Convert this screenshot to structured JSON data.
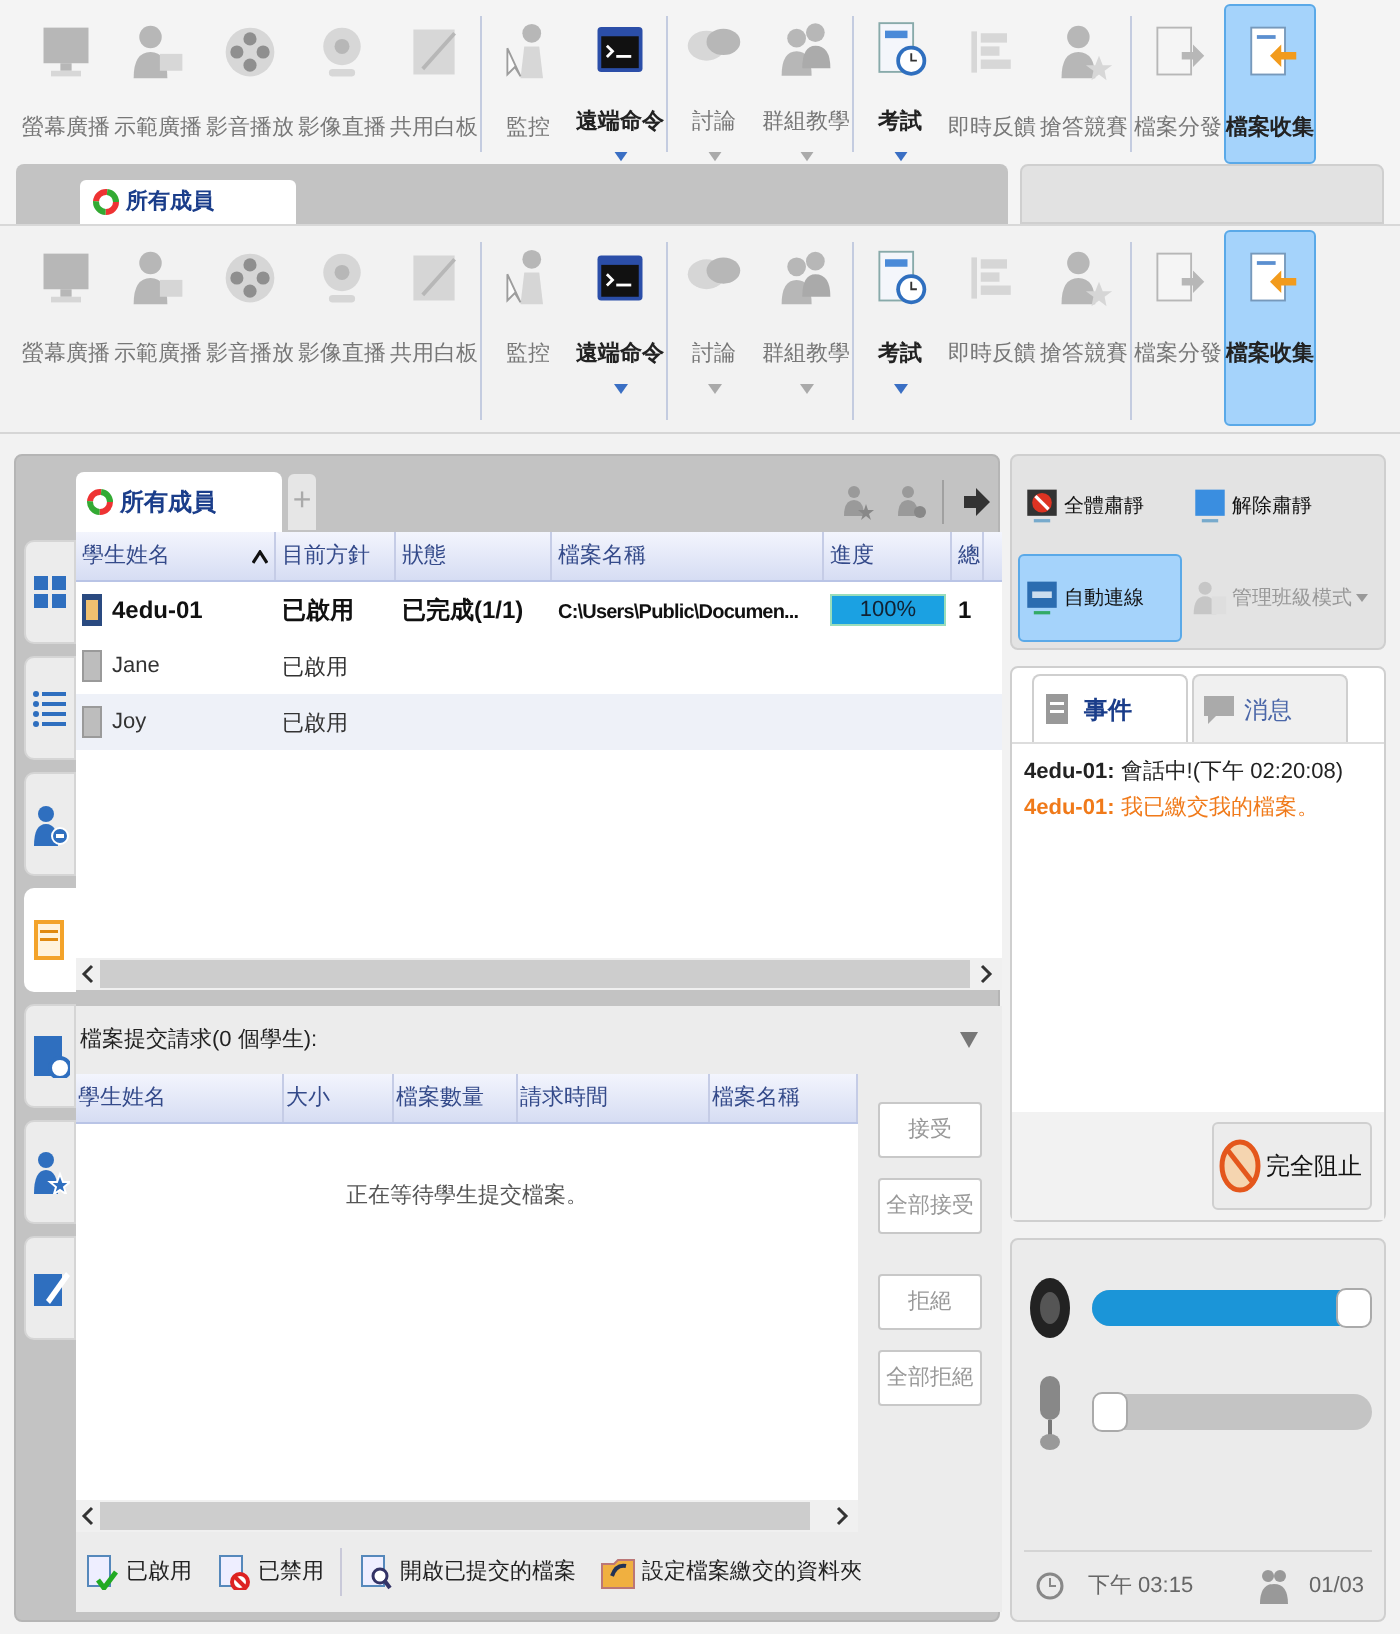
{
  "background_copy": {
    "toolbar": [
      {
        "items": [
          {
            "label": "螢幕廣播",
            "enabled": false,
            "dropdown": false,
            "selected": false
          },
          {
            "label": "示範廣播",
            "enabled": false,
            "dropdown": false,
            "selected": false
          },
          {
            "label": "影音播放",
            "enabled": false,
            "dropdown": false,
            "selected": false
          },
          {
            "label": "影像直播",
            "enabled": false,
            "dropdown": false,
            "selected": false
          },
          {
            "label": "共用白板",
            "enabled": false,
            "dropdown": false,
            "selected": false
          }
        ]
      },
      {
        "items": [
          {
            "label": "監控",
            "enabled": false,
            "dropdown": false,
            "selected": false
          },
          {
            "label": "遠端命令",
            "enabled": true,
            "dropdown": true,
            "selected": false
          }
        ]
      },
      {
        "items": [
          {
            "label": "討論",
            "enabled": false,
            "dropdown": true,
            "selected": false
          },
          {
            "label": "群組教學",
            "enabled": false,
            "dropdown": true,
            "selected": false
          }
        ]
      },
      {
        "items": [
          {
            "label": "考試",
            "enabled": true,
            "dropdown": true,
            "selected": false
          },
          {
            "label": "即時反饋",
            "enabled": false,
            "dropdown": false,
            "selected": false
          },
          {
            "label": "搶答競賽",
            "enabled": false,
            "dropdown": false,
            "selected": false
          }
        ]
      },
      {
        "items": [
          {
            "label": "檔案分發",
            "enabled": false,
            "dropdown": false,
            "selected": false
          },
          {
            "label": "檔案收集",
            "enabled": true,
            "dropdown": false,
            "selected": true
          }
        ]
      }
    ],
    "tab": "所有成員"
  },
  "toolbar": [
    {
      "items": [
        {
          "label": "螢幕廣播",
          "enabled": false,
          "dropdown": false,
          "selected": false
        },
        {
          "label": "示範廣播",
          "enabled": false,
          "dropdown": false,
          "selected": false
        },
        {
          "label": "影音播放",
          "enabled": false,
          "dropdown": false,
          "selected": false
        },
        {
          "label": "影像直播",
          "enabled": false,
          "dropdown": false,
          "selected": false
        },
        {
          "label": "共用白板",
          "enabled": false,
          "dropdown": false,
          "selected": false
        }
      ]
    },
    {
      "items": [
        {
          "label": "監控",
          "enabled": false,
          "dropdown": false,
          "selected": false
        },
        {
          "label": "遠端命令",
          "enabled": true,
          "dropdown": true,
          "selected": false
        }
      ]
    },
    {
      "items": [
        {
          "label": "討論",
          "enabled": false,
          "dropdown": true,
          "selected": false
        },
        {
          "label": "群組教學",
          "enabled": false,
          "dropdown": true,
          "selected": false
        }
      ]
    },
    {
      "items": [
        {
          "label": "考試",
          "enabled": true,
          "dropdown": true,
          "selected": false
        },
        {
          "label": "即時反饋",
          "enabled": false,
          "dropdown": false,
          "selected": false
        },
        {
          "label": "搶答競賽",
          "enabled": false,
          "dropdown": false,
          "selected": false
        }
      ]
    },
    {
      "items": [
        {
          "label": "檔案分發",
          "enabled": false,
          "dropdown": false,
          "selected": false
        },
        {
          "label": "檔案收集",
          "enabled": true,
          "dropdown": false,
          "selected": true
        }
      ]
    }
  ],
  "side_tabs": [
    {
      "selected": false
    },
    {
      "selected": false
    },
    {
      "selected": false
    },
    {
      "selected": true
    },
    {
      "selected": false
    },
    {
      "selected": false
    },
    {
      "selected": false
    }
  ],
  "group_tab": {
    "label": "所有成員",
    "add": "+"
  },
  "students_table": {
    "columns": [
      "學生姓名",
      "目前方針",
      "狀態",
      "檔案名稱",
      "進度",
      "總"
    ],
    "rows": [
      {
        "name": "4edu-01",
        "online": true,
        "policy": "已啟用",
        "status": "已完成(1/1)",
        "file": "C:\\Users\\Public\\Documen...",
        "progress": {
          "level": 1,
          "text": "100%"
        },
        "column_6": "1"
      },
      {
        "name": "Jane",
        "online": false,
        "policy": "已啟用"
      },
      {
        "name": "Joy",
        "online": false,
        "policy": "已啟用"
      }
    ]
  },
  "requests": {
    "title": "檔案提交請求(0 個學生):",
    "columns": [
      "學生姓名",
      "大小",
      "檔案數量",
      "請求時間",
      "檔案名稱"
    ],
    "empty_message": "正在等待學生提交檔案。",
    "buttons": [
      {
        "label": "接受",
        "disabled": true
      },
      {
        "label": "全部接受",
        "disabled": true
      },
      {
        "label": "拒絕",
        "disabled": true
      },
      {
        "label": "全部拒絕",
        "disabled": true
      }
    ]
  },
  "bottom_toolbar": [
    {
      "label": "已啟用"
    },
    {
      "label": "已禁用"
    },
    {
      "label": "開啟已提交的檔案"
    },
    {
      "label": "設定檔案繳交的資料夾"
    }
  ],
  "class_controls": [
    {
      "label": "全體肅靜",
      "selected": false,
      "disabled": false,
      "dropdown": false
    },
    {
      "label": "解除肅靜",
      "selected": false,
      "disabled": false,
      "dropdown": false
    },
    {
      "label": "自動連線",
      "selected": true,
      "disabled": false,
      "dropdown": false
    },
    {
      "label": "管理班級模式",
      "selected": false,
      "disabled": true,
      "dropdown": true
    }
  ],
  "event_tabs": [
    {
      "label": "事件",
      "selected": true
    },
    {
      "label": "消息",
      "selected": false
    }
  ],
  "events": [
    {
      "kind": "info",
      "sender": "4edu-01:",
      "message": "會話中!(下午 02:20:08)"
    },
    {
      "kind": "submit",
      "sender": "4edu-01:",
      "message": "我已繳交我的檔案。"
    }
  ],
  "block_button": "完全阻止",
  "speaker": {
    "level": 1
  },
  "microphone": {
    "level": 0
  },
  "status": {
    "time": "下午 03:15",
    "count": "01/03"
  }
}
